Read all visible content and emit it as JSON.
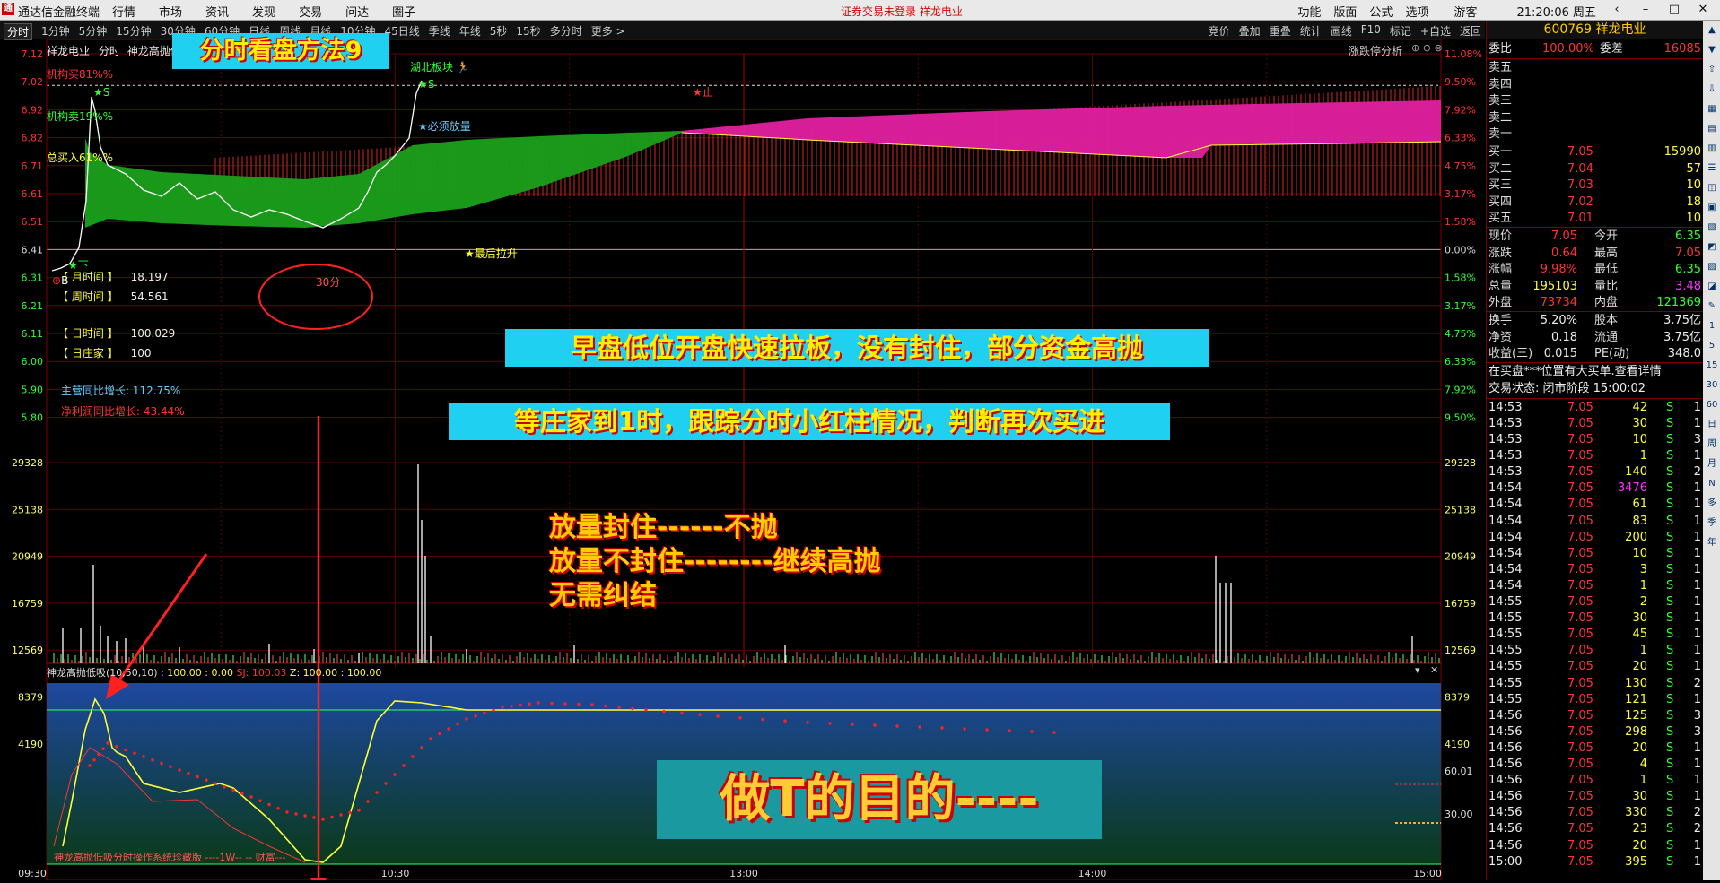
{
  "topbar": {
    "logo": "通",
    "app_name": "通达信金融终端",
    "menu": [
      "行情",
      "市场",
      "资讯",
      "发现",
      "交易",
      "问达",
      "圈子"
    ],
    "notice": "证券交易未登录  祥龙电业",
    "right": [
      "功能",
      "版面",
      "公式",
      "选项",
      "游客"
    ],
    "clock": "21:20:06 周五"
  },
  "tabs": [
    "分时",
    "1分钟",
    "5分钟",
    "15分钟",
    "30分钟",
    "60分钟",
    "日线",
    "周线",
    "月线",
    "10分钟",
    "45日线",
    "季线",
    "年线",
    "5秒",
    "15秒",
    "多分时",
    "更多 >"
  ],
  "tools": [
    "竞价",
    "叠加",
    "重叠",
    "统计",
    "画线",
    "F10",
    "标记",
    "+自选",
    "返回"
  ],
  "chart": {
    "stock_name": "祥龙电业",
    "chart_type": "分时",
    "indicator_name": "神龙高抛低",
    "zt_label": "涨跌停分析",
    "title_banner": "分时看盘方法9",
    "price_axis": [
      "7.12",
      "7.02",
      "6.92",
      "6.82",
      "6.71",
      "6.61",
      "6.51",
      "6.41",
      "6.31",
      "6.21",
      "6.11",
      "6.00",
      "5.90",
      "5.80"
    ],
    "pct_axis": [
      "11.08%",
      "9.50%",
      "7.92%",
      "6.33%",
      "4.75%",
      "3.17%",
      "1.58%",
      "0.00%",
      "1.58%",
      "3.17%",
      "4.75%",
      "6.33%",
      "7.92%",
      "9.50%"
    ],
    "vol_axis": [
      "29328",
      "25138",
      "20949",
      "16759",
      "12569",
      "8379",
      "4190"
    ],
    "osc_axis": [
      "60.01",
      "30.00"
    ],
    "time_axis": [
      "09:30",
      "10:30",
      "13:00",
      "14:00",
      "15:00"
    ],
    "labels": {
      "inst_buy": "机构买81%%",
      "inst_sell": "机构卖19%%",
      "total_buy": "总买入61%%",
      "s1": "S",
      "s2": "S",
      "xia": "下",
      "b": "B",
      "hubei": "湖北板块",
      "must": "必须放量",
      "last_pull": "最后拉升",
      "thirty": "30分",
      "zhi": "止"
    },
    "info": {
      "month_label": "【 月时间 】",
      "month_val": "18.197",
      "week_label": "【 周时间 】",
      "week_val": "54.561",
      "day_label": "【 日时间 】",
      "day_val": "100.029",
      "dealer_label": "【 日庄家 】",
      "dealer_val": "100",
      "rev_growth": "主营同比增长: 112.75%",
      "profit_growth": "净利润同比增长: 43.44%"
    },
    "annotations": {
      "box1": "早盘低位开盘快速拉板，没有封住，部分资金高抛",
      "box2": "等庄家到1时，跟踪分时小红柱情况，判断再次买进",
      "line1": "放量封住------不抛",
      "line2": "放量不封住--------继续高抛",
      "line3": "无需纠结",
      "big": "做T的目的----"
    },
    "osc_header": {
      "name": "神龙高抛低吸(10,50,10) :",
      "v1": "100.00",
      "v2": ": 0.00",
      "v3": "SJ: 100.03",
      "v4": "Z: 100.00",
      "v5": ": 100.00"
    },
    "osc_footer": "神龙高抛低吸分时操作系统珍藏版 ----1W-- -- 财富---",
    "colors": {
      "green_band": "#1aa01a",
      "magenta_band": "#e020a0",
      "price_line": "#ffffff",
      "osc_yellow": "#ffff33",
      "osc_dots": "#ff2020",
      "osc_bg": "#1e4a90"
    }
  },
  "panel": {
    "code_name": "600769 祥龙电业",
    "weibi_label": "委比",
    "weibi_val": "100.00%",
    "weicha_label": "委差",
    "weicha_val": "16085",
    "sell": [
      {
        "label": "卖五",
        "price": "",
        "vol": ""
      },
      {
        "label": "卖四",
        "price": "",
        "vol": ""
      },
      {
        "label": "卖三",
        "price": "",
        "vol": ""
      },
      {
        "label": "卖二",
        "price": "",
        "vol": ""
      },
      {
        "label": "卖一",
        "price": "",
        "vol": ""
      }
    ],
    "buy": [
      {
        "label": "买一",
        "price": "7.05",
        "vol": "15990"
      },
      {
        "label": "买二",
        "price": "7.04",
        "vol": "57"
      },
      {
        "label": "买三",
        "price": "7.03",
        "vol": "10"
      },
      {
        "label": "买四",
        "price": "7.02",
        "vol": "18"
      },
      {
        "label": "买五",
        "price": "7.01",
        "vol": "10"
      }
    ],
    "stats": [
      {
        "l1": "现价",
        "v1": "7.05",
        "l2": "今开",
        "v2": "6.35"
      },
      {
        "l1": "涨跌",
        "v1": "0.64",
        "l2": "最高",
        "v2": "7.05"
      },
      {
        "l1": "涨幅",
        "v1": "9.98%",
        "l2": "最低",
        "v2": "6.35"
      },
      {
        "l1": "总量",
        "v1": "195103",
        "l2": "量比",
        "v2": "3.48"
      },
      {
        "l1": "外盘",
        "v1": "73734",
        "l2": "内盘",
        "v2": "121369"
      }
    ],
    "stats2": [
      {
        "l1": "换手",
        "v1": "5.20%",
        "l2": "股本",
        "v2": "3.75亿"
      },
      {
        "l1": "净资",
        "v1": "0.18",
        "l2": "流通",
        "v2": "3.75亿"
      },
      {
        "l1": "收益(三)",
        "v1": "0.015",
        "l2": "PE(动)",
        "v2": "348.0"
      }
    ],
    "notice1": "在买盘***位置有大买单.查看详情",
    "status": "交易状态: 闭市阶段 15:00:02",
    "ticks": [
      {
        "t": "14:53",
        "p": "7.05",
        "v": "42",
        "d": "S",
        "n": "1"
      },
      {
        "t": "14:53",
        "p": "7.05",
        "v": "30",
        "d": "S",
        "n": "1"
      },
      {
        "t": "14:53",
        "p": "7.05",
        "v": "10",
        "d": "S",
        "n": "3"
      },
      {
        "t": "14:53",
        "p": "7.05",
        "v": "1",
        "d": "S",
        "n": "1"
      },
      {
        "t": "14:53",
        "p": "7.05",
        "v": "140",
        "d": "S",
        "n": "2"
      },
      {
        "t": "14:54",
        "p": "7.05",
        "v": "3476",
        "d": "S",
        "n": "1"
      },
      {
        "t": "14:54",
        "p": "7.05",
        "v": "61",
        "d": "S",
        "n": "1"
      },
      {
        "t": "14:54",
        "p": "7.05",
        "v": "83",
        "d": "S",
        "n": "1"
      },
      {
        "t": "14:54",
        "p": "7.05",
        "v": "200",
        "d": "S",
        "n": "1"
      },
      {
        "t": "14:54",
        "p": "7.05",
        "v": "10",
        "d": "S",
        "n": "1"
      },
      {
        "t": "14:54",
        "p": "7.05",
        "v": "3",
        "d": "S",
        "n": "1"
      },
      {
        "t": "14:54",
        "p": "7.05",
        "v": "1",
        "d": "S",
        "n": "1"
      },
      {
        "t": "14:55",
        "p": "7.05",
        "v": "2",
        "d": "S",
        "n": "1"
      },
      {
        "t": "14:55",
        "p": "7.05",
        "v": "30",
        "d": "S",
        "n": "1"
      },
      {
        "t": "14:55",
        "p": "7.05",
        "v": "45",
        "d": "S",
        "n": "1"
      },
      {
        "t": "14:55",
        "p": "7.05",
        "v": "1",
        "d": "S",
        "n": "1"
      },
      {
        "t": "14:55",
        "p": "7.05",
        "v": "20",
        "d": "S",
        "n": "1"
      },
      {
        "t": "14:55",
        "p": "7.05",
        "v": "130",
        "d": "S",
        "n": "2"
      },
      {
        "t": "14:55",
        "p": "7.05",
        "v": "121",
        "d": "S",
        "n": "1"
      },
      {
        "t": "14:56",
        "p": "7.05",
        "v": "125",
        "d": "S",
        "n": "3"
      },
      {
        "t": "14:56",
        "p": "7.05",
        "v": "298",
        "d": "S",
        "n": "3"
      },
      {
        "t": "14:56",
        "p": "7.05",
        "v": "20",
        "d": "S",
        "n": "1"
      },
      {
        "t": "14:56",
        "p": "7.05",
        "v": "4",
        "d": "S",
        "n": "1"
      },
      {
        "t": "14:56",
        "p": "7.05",
        "v": "1",
        "d": "S",
        "n": "1"
      },
      {
        "t": "14:56",
        "p": "7.05",
        "v": "30",
        "d": "S",
        "n": "1"
      },
      {
        "t": "14:56",
        "p": "7.05",
        "v": "330",
        "d": "S",
        "n": "2"
      },
      {
        "t": "14:56",
        "p": "7.05",
        "v": "23",
        "d": "S",
        "n": "2"
      },
      {
        "t": "14:56",
        "p": "7.05",
        "v": "20",
        "d": "S",
        "n": "1"
      },
      {
        "t": "15:00",
        "p": "7.05",
        "v": "395",
        "d": "S",
        "n": "1"
      }
    ],
    "sidebar": [
      "1",
      "5",
      "15",
      "30",
      "60",
      "日",
      "周",
      "月",
      "N",
      "多",
      "季",
      "年"
    ]
  }
}
